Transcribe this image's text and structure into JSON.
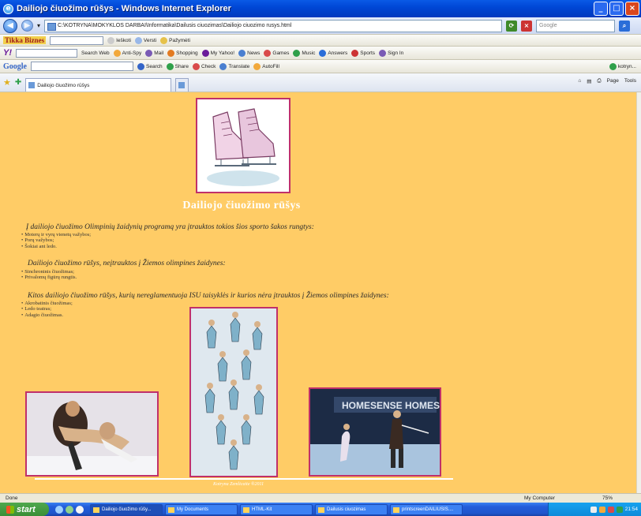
{
  "window": {
    "title": "Dailiojo čiuožimo rūšys - Windows Internet Explorer",
    "min": "_",
    "max": "□",
    "close": "×"
  },
  "address": {
    "back": "◀",
    "forward": "▶",
    "dropdown": "▾",
    "url": "C:\\KOTRYNA\\MOKYKLOS DARBAI\\Informatika\\Dailusis ciuozimas\\Dailiojo ciuozimo rusys.html",
    "search_placeholder": "Google"
  },
  "toolbar1": {
    "logo": "Tikka Biznes",
    "items": [
      "Ieškoti",
      "Versti",
      "Pažymėti"
    ]
  },
  "toolbar2": {
    "logo": "Y!",
    "search_web": "Search Web",
    "items": [
      "Anti-Spy",
      "Mail",
      "Shopping",
      "My Yahoo!",
      "News",
      "Games",
      "Music",
      "Answers",
      "Sports",
      "Sign In"
    ]
  },
  "toolbar3": {
    "logo": "Google",
    "items": [
      "Search",
      "Share",
      "Check",
      "Translate",
      "AutoFill"
    ],
    "user": "kotryn..."
  },
  "tabs": {
    "active": "Dailiojo čiuožimo rūšys",
    "right": [
      "Page",
      "Tools"
    ]
  },
  "content": {
    "title": "Dailiojo čiuožimo rūšys",
    "sections": [
      {
        "intro": "Į dailiojo čiuožimo Olimpinių žaidynių programą yra įtrauktos tokios šios sporto šakos rungtys:",
        "items": [
          "Moterų ir vyrų vienetų važybos;",
          "Porų važybos;",
          "Šokiai ant ledo."
        ]
      },
      {
        "intro": "Dailiojo čiuožimo rūšys, neįtrauktos į Žiemos olimpines žaidynes:",
        "items": [
          "Sinchroninis čiuožimas;",
          "Privalomų figūrų rungtis."
        ]
      },
      {
        "intro": "Kitos dailiojo čiuožimo rūšys, kurių nereglamentuoja ISU taisyklės ir kurios nėra įtrauktos į Žiemos olimpines žaidynes:",
        "items": [
          "Akrobatinis čiuožimas;",
          "Ledo teatras;",
          "Adagio čiuožimas."
        ]
      }
    ],
    "banner_text": "HOMESENSE HOMESENSE",
    "footer": "Kotryna Zemlicaite ®2011"
  },
  "status": {
    "left": "Done",
    "zone": "My Computer",
    "zoom": "75%"
  },
  "taskbar": {
    "start": "start",
    "tasks": [
      "Dailiojo čiuožimo rūšy...",
      "My Documents",
      "HTML-Kit",
      "Dailusis ciuozimas",
      "printscreenDAILIUSIS...."
    ],
    "clock": "21:54"
  },
  "colors": {
    "page_bg": "#ffcc66",
    "frame": "#c0306a",
    "title_text": "#ffffff"
  }
}
